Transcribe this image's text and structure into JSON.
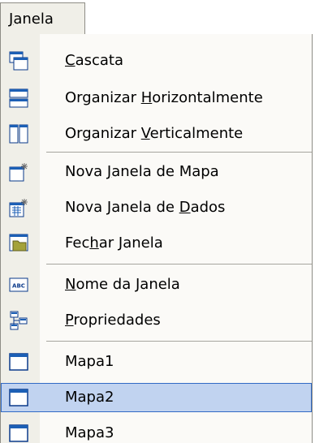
{
  "menu": {
    "title_pre": "",
    "title_mnemonic": "J",
    "title_post": "anela"
  },
  "items": [
    {
      "pre": "",
      "mn": "C",
      "post": "ascata",
      "icon": "cascade-windows-icon"
    },
    {
      "pre": "Organizar ",
      "mn": "H",
      "post": "orizontalmente",
      "icon": "tile-horizontal-icon"
    },
    {
      "pre": "Organizar ",
      "mn": "V",
      "post": "erticalmente",
      "icon": "tile-vertical-icon"
    },
    {
      "pre": "Nova ",
      "mn": "J",
      "post": "anela de Mapa",
      "icon": "new-map-window-icon"
    },
    {
      "pre": "Nova Janela de ",
      "mn": "D",
      "post": "ados",
      "icon": "new-data-window-icon"
    },
    {
      "pre": "Fec",
      "mn": "h",
      "post": "ar Janela",
      "icon": "close-window-folder-icon"
    },
    {
      "pre": "",
      "mn": "N",
      "post": "ome da Janela",
      "icon": "abc-rename-icon"
    },
    {
      "pre": "",
      "mn": "P",
      "post": "ropriedades",
      "icon": "properties-icon"
    },
    {
      "pre": "Mapa1",
      "mn": "",
      "post": "",
      "icon": "window-icon"
    },
    {
      "pre": "Mapa2",
      "mn": "",
      "post": "",
      "icon": "window-icon"
    },
    {
      "pre": "Mapa3",
      "mn": "",
      "post": "",
      "icon": "window-icon"
    }
  ],
  "selected_item": "Mapa2",
  "colors": {
    "selection_fill": "#c1d3f0",
    "selection_border": "#316ac5",
    "icon_blue": "#1c5fb5",
    "icon_frame": "#0a3a8a"
  }
}
